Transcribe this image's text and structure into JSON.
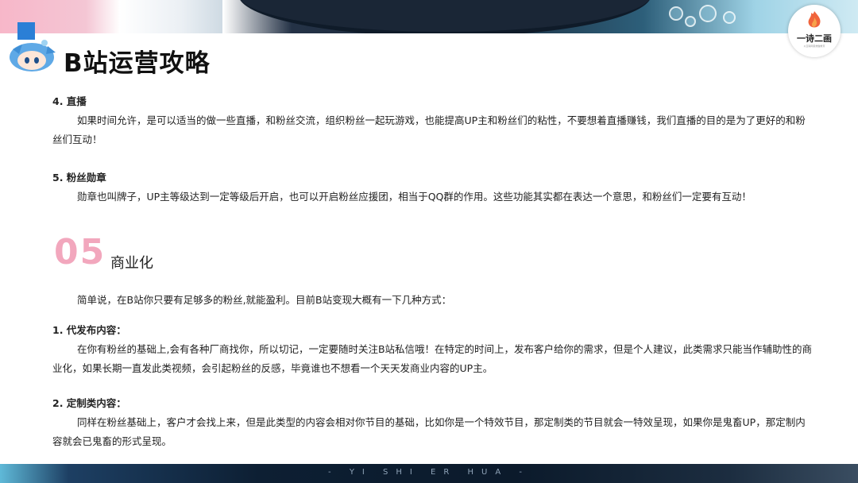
{
  "header": {
    "title": "B站运营攻略",
    "logo_text": "一诗二画",
    "logo_subtext": "以互联网思维做教育"
  },
  "footer": {
    "text": "- YI SHI ER HUA -"
  },
  "section4": {
    "heading": "4. 直播",
    "para": "如果时间允许，是可以适当的做一些直播，和粉丝交流，组织粉丝一起玩游戏，也能提高UP主和粉丝们的粘性，不要想着直播赚钱，我们直播的目的是为了更好的和粉丝们互动！"
  },
  "section5": {
    "heading": "5. 粉丝勋章",
    "para": "勋章也叫牌子，UP主等级达到一定等级后开启，也可以开启粉丝应援团，相当于QQ群的作用。这些功能其实都在表达一个意思，和粉丝们一定要有互动！"
  },
  "chapter": {
    "number": "05",
    "title": "商业化"
  },
  "intro": "简单说，在B站你只要有足够多的粉丝,就能盈利。目前B站变现大概有一下几种方式：",
  "item1": {
    "heading": "1. 代发布内容：",
    "para": "在你有粉丝的基础上,会有各种厂商找你，所以切记，一定要随时关注B站私信哦！在特定的时间上，发布客户给你的需求，但是个人建议，此类需求只能当作辅助性的商业化，如果长期一直发此类视频，会引起粉丝的反感，毕竟谁也不想看一个天天发商业内容的UP主。"
  },
  "item2": {
    "heading": "2. 定制类内容：",
    "para": "同样在粉丝基础上，客户才会找上来，但是此类型的内容会相对你节目的基础，比如你是一个特效节目，那定制类的节目就会一特效呈现，如果你是鬼畜UP，那定制内容就会已鬼畜的形式呈现。"
  },
  "colors": {
    "accent_pink": "#f2a7bd",
    "accent_blue": "#2b7fd6",
    "banner_dark": "#1b2a3c"
  }
}
